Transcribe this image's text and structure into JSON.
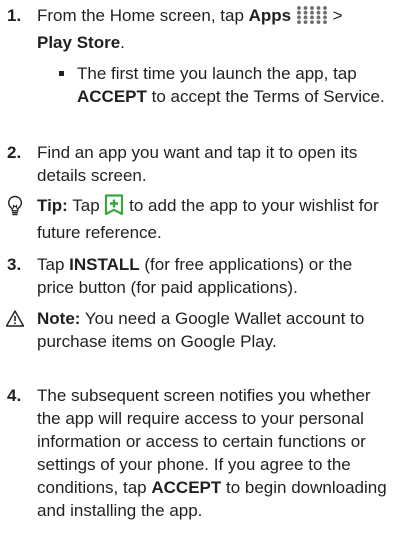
{
  "steps": [
    {
      "number": "1.",
      "line1_pre": "From the Home screen, tap ",
      "line1_bold": "Apps",
      "line1_post": " > ",
      "line2_bold": "Play Store",
      "line2_post": ".",
      "apps_icon": "apps-grid-icon"
    },
    {
      "number": "2.",
      "text": "Find an app you want and tap it to open its details screen."
    },
    {
      "number": "3.",
      "pre": "Tap ",
      "bold": "INSTALL",
      "post": " (for free applications) or the price button (for paid applications)."
    },
    {
      "number": "4.",
      "pre": "The subsequent screen notifies you whether the app will require access to your personal information or access to certain functions or settings of your phone. If you agree to the conditions, tap ",
      "bold": "ACCEPT",
      "post": " to begin downloading and installing the app."
    }
  ],
  "substep": {
    "pre": "The first time you launch the app, tap ",
    "bold": "ACCEPT",
    "post": " to accept the Terms of Service."
  },
  "tip": {
    "label": "Tip:",
    "pre": " Tap ",
    "post": " to add the app to your wishlist for future reference.",
    "icon": "lightbulb-icon",
    "wishlist_icon": "wishlist-add-icon"
  },
  "note": {
    "label": "Note:",
    "text": " You need a Google Wallet account to purchase items on Google Play.",
    "icon": "warning-triangle-icon"
  },
  "colors": {
    "text": "#231f20",
    "wishlist_green": "#3aa63e",
    "icon_gray": "#6d6e71"
  }
}
